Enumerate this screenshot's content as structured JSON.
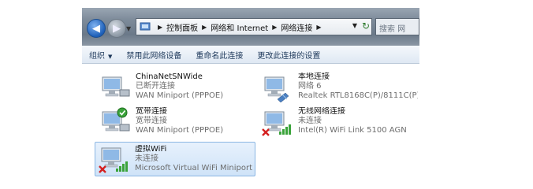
{
  "breadcrumb": [
    "控制面板",
    "网络和 Internet",
    "网络连接"
  ],
  "search_placeholder": "搜索 网",
  "toolbar": {
    "organize_label": "组织",
    "disable_label": "禁用此网络设备",
    "rename_label": "重命名此连接",
    "change_label": "更改此连接的设置"
  },
  "connections": [
    {
      "name": "ChinaNetSNWide",
      "status": "已断开连接",
      "device": "WAN Miniport (PPPOE)",
      "icon": "broadband-icon"
    },
    {
      "name": "本地连接",
      "status": "网络 6",
      "device": "Realtek RTL8168C(P)/8111C(P)...",
      "icon": "ethernet-icon"
    },
    {
      "name": "宽带连接",
      "status": "宽带连接",
      "device": "WAN Miniport (PPPOE)",
      "icon": "broadband-connected-icon"
    },
    {
      "name": "无线网络连接",
      "status": "未连接",
      "device": "Intel(R) WiFi Link 5100 AGN",
      "icon": "wireless-disconnected-icon"
    },
    {
      "name": "虚拟WiFi",
      "status": "未连接",
      "device": "Microsoft Virtual WiFi Miniport ...",
      "icon": "wireless-disconnected-icon"
    }
  ],
  "colors": {
    "selection": "#cfe3f8",
    "status_ok": "#3aa33a",
    "status_error": "#d42020",
    "toolbar_text": "#1e395b"
  }
}
